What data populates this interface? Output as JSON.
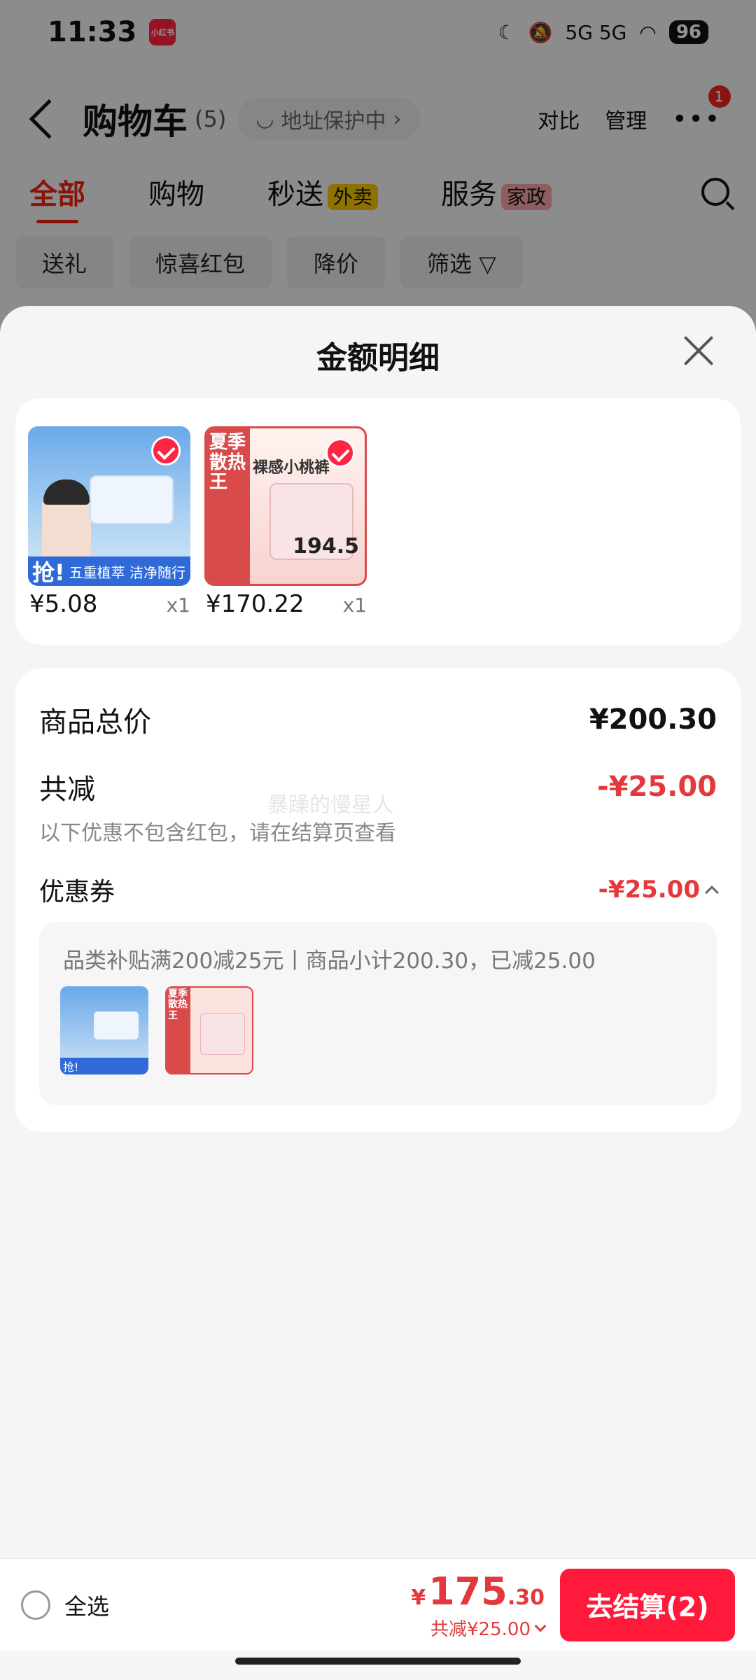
{
  "status": {
    "time": "11:33",
    "app_badge": "小红书",
    "signal": "5G 5G",
    "battery": "96"
  },
  "nav": {
    "title": "购物车",
    "count": "(5)",
    "address_protect": "地址保护中",
    "compare": "对比",
    "manage": "管理",
    "more_badge": "1"
  },
  "tabs": [
    {
      "label": "全部"
    },
    {
      "label": "购物"
    },
    {
      "label": "秒送",
      "badge": "外卖"
    },
    {
      "label": "服务",
      "badge": "家政"
    }
  ],
  "filters": [
    "送礼",
    "惊喜红包",
    "降价",
    "筛选"
  ],
  "sheet": {
    "title": "金额明细",
    "products": [
      {
        "price": "¥5.08",
        "qty": "x1",
        "banner_grab": "抢!",
        "banner_text": "五重植萃 洁净随行"
      },
      {
        "price": "¥170.22",
        "qty": "x1",
        "side_text": "夏季 散热王",
        "brand_line": "裸感小桃裤",
        "price_tag": "194.5"
      }
    ],
    "summary": {
      "total_label": "商品总价",
      "total_value": "¥200.30",
      "discount_label": "共减",
      "discount_value": "-¥25.00",
      "discount_note": "以下优惠不包含红包，请在结算页查看",
      "watermark": "暴躁的慢星人",
      "coupon_label": "优惠券",
      "coupon_value": "-¥25.00",
      "coupon_detail": "品类补贴满200减25元丨商品小计200.30，已减25.00",
      "thumb1_band": "抢!",
      "thumb2_side": "夏季 散热王"
    }
  },
  "bottom": {
    "select_all": "全选",
    "currency": "¥",
    "total_int": "175",
    "total_dec": ".30",
    "saved": "共减¥25.00",
    "checkout": "去结算(2)"
  },
  "colors": {
    "accent_red": "#ff1a3c",
    "price_red": "#e4393c"
  }
}
